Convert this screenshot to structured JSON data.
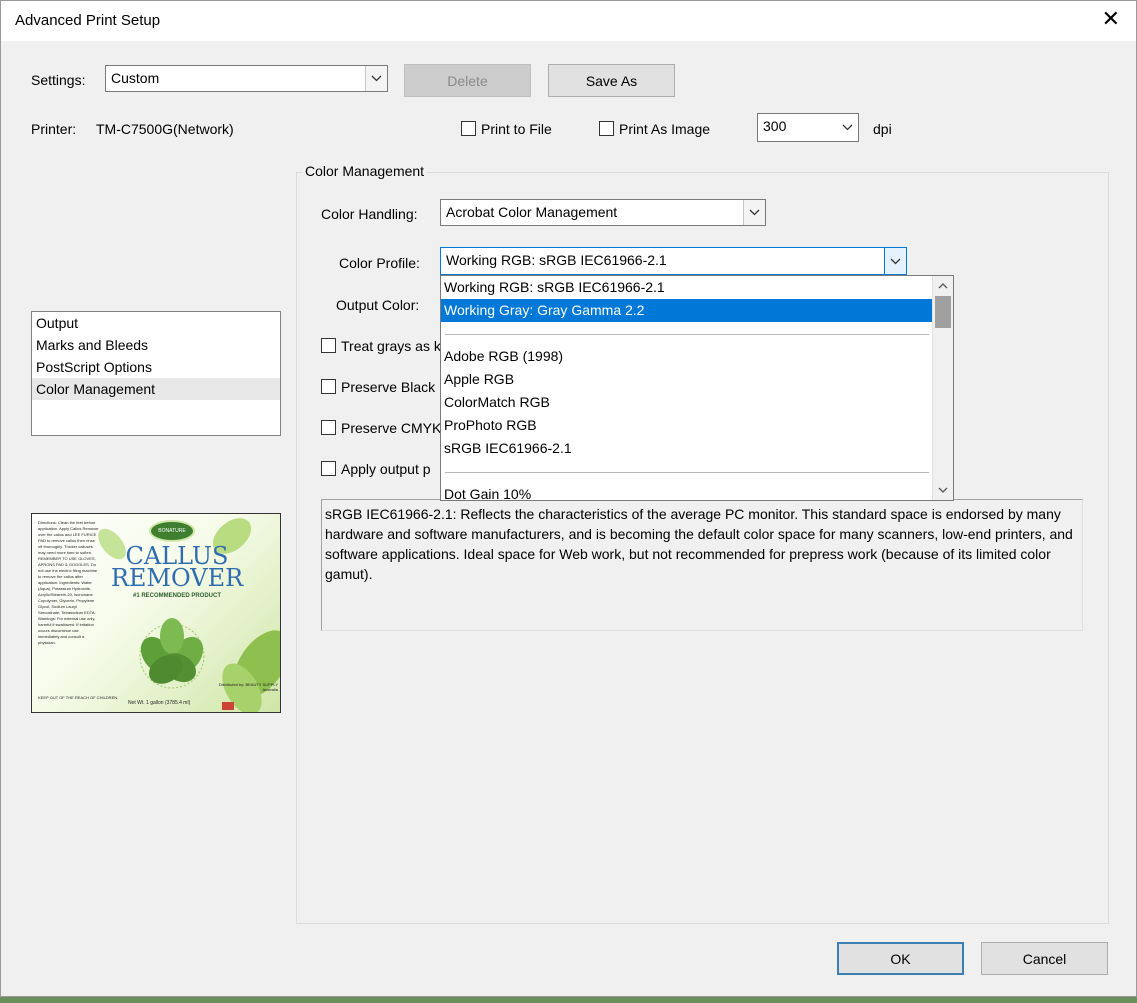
{
  "dialog": {
    "title": "Advanced Print Setup",
    "close_glyph": "✕"
  },
  "settings": {
    "label": "Settings:",
    "value": "Custom",
    "delete_label": "Delete",
    "save_as_label": "Save As"
  },
  "printer": {
    "label": "Printer:",
    "name": "TM-C7500G(Network)",
    "print_to_file_label": "Print to File",
    "print_to_file_checked": false,
    "print_as_image_label": "Print As Image",
    "print_as_image_checked": false,
    "dpi_value": "300",
    "dpi_unit": "dpi"
  },
  "nav": {
    "items": [
      {
        "label": "Output"
      },
      {
        "label": "Marks and Bleeds"
      },
      {
        "label": "PostScript Options"
      },
      {
        "label": "Color Management",
        "selected": true
      }
    ]
  },
  "color_management": {
    "group_title": "Color Management",
    "color_handling_label": "Color Handling:",
    "color_handling_value": "Acrobat Color Management",
    "color_profile_label": "Color Profile:",
    "color_profile_value": "Working RGB: sRGB IEC61966-2.1",
    "output_color_label": "Output Color:",
    "treat_grays_label": "Treat grays as k",
    "preserve_black_label": "Preserve Black",
    "preserve_cmyk_label": "Preserve CMYK",
    "apply_output_label": "Apply output p",
    "description": "sRGB IEC61966-2.1:  Reflects the characteristics of the average PC monitor.  This standard space is endorsed by many hardware and software manufacturers, and is becoming the default color space for many scanners, low-end printers, and software applications. Ideal space for Web work, but not recommended for prepress work (because of its limited color gamut)."
  },
  "profile_dropdown": {
    "options": [
      "Working RGB: sRGB IEC61966-2.1",
      "Working Gray: Gray Gamma 2.2",
      "Adobe RGB (1998)",
      "Apple RGB",
      "ColorMatch RGB",
      "ProPhoto RGB",
      "sRGB IEC61966-2.1",
      "Dot Gain 10%"
    ],
    "highlighted_index": 1
  },
  "preview": {
    "left_text": "Directions: Clean the feet before application. Apply Callus Remover over the callus and LEE FURICE PAD to remove callus then rinse off thoroughly. Thicker calluses may need more time to soften. REMEMBER TO USE GLOVES, APRONS PAD & GOGGLES. Do not use the electric filing machine to remove the callus after application. Ingredients: Water (Aqua), Potassium Hydroxide, Acrylic/Steareth-20, Isononane Copolymer, Glycerin, Propylene Glycol, Sodium Lauryl Sarcosinate, Tetrasodium EDTA. Warnings: For external use only, harmful if swallowed. If irritation occurs discontinue use immediately and consult a physician.",
    "keep_out": "KEEP OUT OF THE REACH OF CHILDREN.",
    "logo": "BONATURE",
    "title_line1": "CALLUS",
    "title_line2": "REMOVER",
    "subtitle": "#1 RECOMMENDED PRODUCT",
    "net": "Net Wt. 1 gallon  (3785.4 ml)",
    "distributed": "Distributed by: BEAUTY SUPPLY Australia"
  },
  "buttons": {
    "ok_label": "OK",
    "cancel_label": "Cancel"
  },
  "icons": {
    "dropdown_arrow": "﹀",
    "scroll_up": "⌃",
    "scroll_down": "⌄"
  }
}
